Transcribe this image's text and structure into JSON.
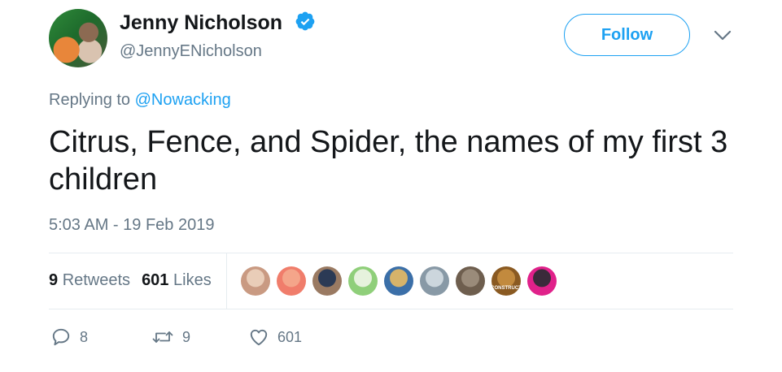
{
  "author": {
    "name": "Jenny Nicholson",
    "handle": "@JennyENicholson",
    "verified": true
  },
  "header": {
    "follow_label": "Follow",
    "menu_icon": "chevron-down-icon"
  },
  "reply": {
    "prefix": "Replying to ",
    "mention": "@Nowacking"
  },
  "tweet": {
    "text": "Citrus, Fence, and Spider, the names of my first 3 children",
    "timestamp": "5:03 AM - 19 Feb 2019"
  },
  "stats": {
    "retweets_count": "9",
    "retweets_label": "Retweets",
    "likes_count": "601",
    "likes_label": "Likes"
  },
  "likers": [
    {
      "colors": [
        "#e9cdb8",
        "#c99a82"
      ]
    },
    {
      "colors": [
        "#f4a58a",
        "#f07d6b"
      ]
    },
    {
      "colors": [
        "#2b3a55",
        "#9a7a62"
      ]
    },
    {
      "colors": [
        "#e6f2dd",
        "#8fcf7a"
      ]
    },
    {
      "colors": [
        "#d6b36a",
        "#3b6fa8"
      ]
    },
    {
      "colors": [
        "#ccd6dd",
        "#8899a6"
      ]
    },
    {
      "colors": [
        "#9a8b7a",
        "#6e5e4e"
      ]
    },
    {
      "colors": [
        "#c28a3e",
        "#8a5a22"
      ],
      "text": "CONSTRUCT"
    },
    {
      "colors": [
        "#3a2a3a",
        "#e0218a"
      ]
    }
  ],
  "actions": {
    "reply_count": "8",
    "retweet_count": "9",
    "like_count": "601"
  },
  "colors": {
    "accent": "#1da1f2",
    "muted": "#657786",
    "text": "#14171a",
    "border": "#e6ecf0"
  }
}
